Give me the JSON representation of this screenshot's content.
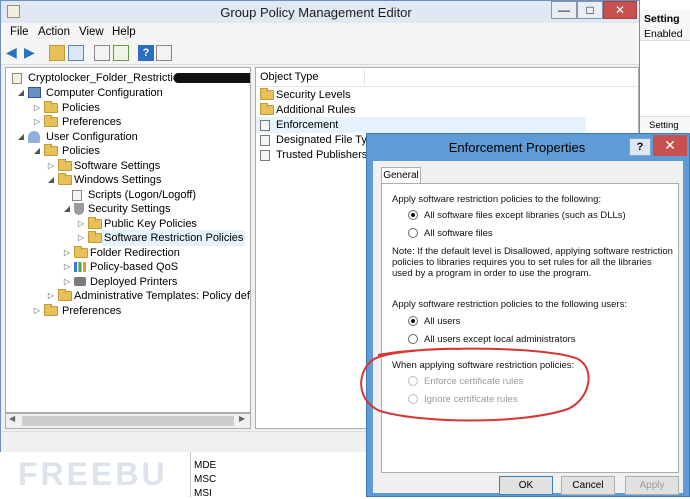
{
  "window": {
    "title": "Group Policy Management Editor",
    "minimize": "—",
    "maximize": "□",
    "close": "✕"
  },
  "menu": [
    "File",
    "Action",
    "View",
    "Help"
  ],
  "tree": {
    "root": "Cryptolocker_Folder_Restrictions",
    "items": [
      "Computer Configuration",
      "Policies",
      "Preferences",
      "User Configuration",
      "Policies",
      "Software Settings",
      "Windows Settings",
      "Scripts (Logon/Logoff)",
      "Security Settings",
      "Public Key Policies",
      "Software Restriction Policies",
      "Folder Redirection",
      "Policy-based QoS",
      "Deployed Printers",
      "Administrative Templates: Policy definiti",
      "Preferences"
    ]
  },
  "list": {
    "header": "Object Type",
    "items": [
      "Security Levels",
      "Additional Rules",
      "Enforcement",
      "Designated File Types",
      "Trusted Publishers"
    ]
  },
  "background": {
    "setting_header": "Setting",
    "enabled": "Enabled",
    "setting2": "Setting",
    "bottom_list": [
      "MDE",
      "MSC",
      "MSI"
    ],
    "watermark": "FREEBU"
  },
  "dialog": {
    "title": "Enforcement Properties",
    "help": "?",
    "close": "✕",
    "tab": "General",
    "section1": "Apply software restriction policies to the following:",
    "opt1a": "All software files except libraries (such as DLLs)",
    "opt1b": "All software files",
    "note": "Note:  If the default level is Disallowed, applying software restriction policies to libraries requires you to set rules for all the libraries used by a program in order to use the program.",
    "section2": "Apply software restriction policies to the following users:",
    "opt2a": "All users",
    "opt2b": "All users except local administrators",
    "section3": "When applying software restriction policies:",
    "opt3a": "Enforce certificate rules",
    "opt3b": "Ignore certificate rules",
    "ok": "OK",
    "cancel": "Cancel",
    "apply": "Apply"
  },
  "colors": {
    "annotation": "#d93535",
    "dialog_frame": "#5f9cd6",
    "close_red": "#c75050"
  }
}
